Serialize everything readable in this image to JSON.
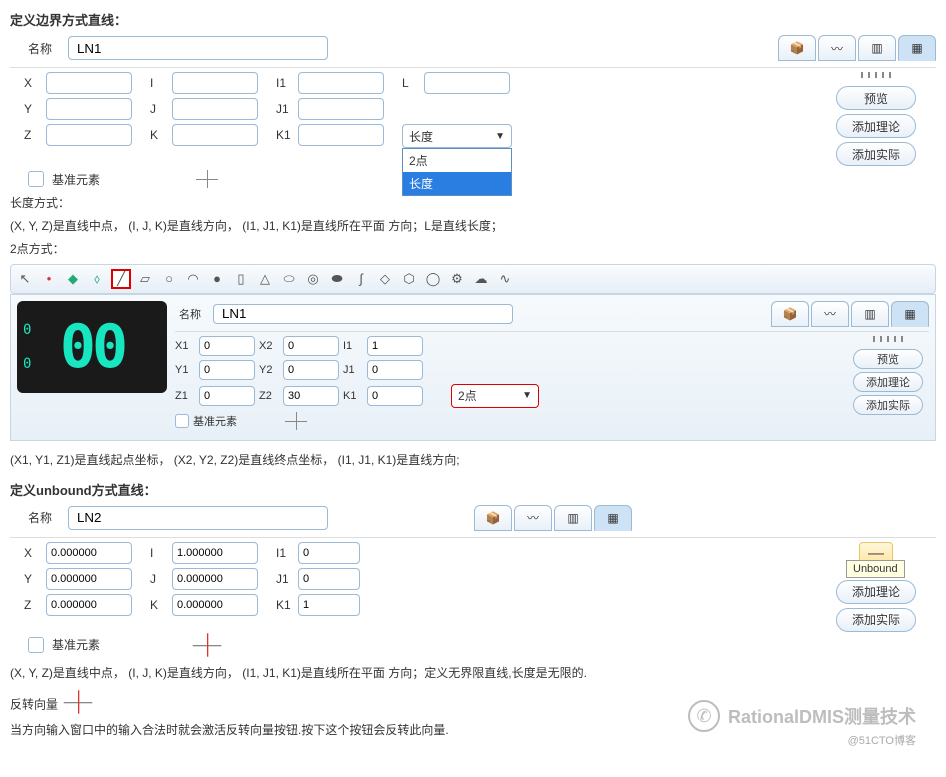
{
  "sec1": {
    "title": "定义边界方式直线：",
    "name_label": "名称",
    "name_value": "LN1",
    "labels": {
      "X": "X",
      "Y": "Y",
      "Z": "Z",
      "I": "I",
      "J": "J",
      "K": "K",
      "I1": "I1",
      "J1": "J1",
      "K1": "K1",
      "L": "L"
    },
    "datum": "基准元素",
    "dropdown": {
      "current": "长度",
      "opt1": "2点",
      "opt2": "长度"
    },
    "buttons": {
      "preview": "预览",
      "addTheory": "添加理论",
      "addActual": "添加实际"
    },
    "desc_label": "长度方式：",
    "desc": "(X, Y, Z)是直线中点， (I, J, K)是直线方向， (I1, J1, K1)是直线所在平面 方向；L是直线长度；",
    "desc2_label": "2点方式："
  },
  "sec2": {
    "name_label": "名称",
    "name_value": "LN1",
    "counter": "00",
    "counter_side1": "0",
    "counter_side2": "0",
    "labels": {
      "X1": "X1",
      "Y1": "Y1",
      "Z1": "Z1",
      "X2": "X2",
      "Y2": "Y2",
      "Z2": "Z2",
      "I1": "I1",
      "J1": "J1",
      "K1": "K1"
    },
    "vals": {
      "X1": "0",
      "Y1": "0",
      "Z1": "0",
      "X2": "0",
      "Y2": "0",
      "Z2": "30",
      "I1": "1",
      "J1": "0",
      "K1": "0"
    },
    "dropdown": "2点",
    "datum": "基准元素",
    "buttons": {
      "preview": "预览",
      "addTheory": "添加理论",
      "addActual": "添加实际"
    },
    "desc": "(X1, Y1, Z1)是直线起点坐标， (X2, Y2, Z2)是直线终点坐标， (I1, J1, K1)是直线方向;"
  },
  "sec3": {
    "title": "定义unbound方式直线：",
    "name_label": "名称",
    "name_value": "LN2",
    "labels": {
      "X": "X",
      "Y": "Y",
      "Z": "Z",
      "I": "I",
      "J": "J",
      "K": "K",
      "I1": "I1",
      "J1": "J1",
      "K1": "K1"
    },
    "vals": {
      "X": "0.000000",
      "Y": "0.000000",
      "Z": "0.000000",
      "I": "1.000000",
      "J": "0.000000",
      "K": "0.000000",
      "I1": "0",
      "J1": "0",
      "K1": "1"
    },
    "datum": "基准元素",
    "tooltip": "Unbound",
    "buttons": {
      "addTheory": "添加理论",
      "addActual": "添加实际"
    },
    "desc": "(X, Y, Z)是直线中点， (I, J, K)是直线方向， (I1, J1, K1)是直线所在平面 方向；定义无界限直线,长度是无限的."
  },
  "sec4": {
    "title": "反转向量",
    "desc": "当方向输入窗口中的输入合法时就会激活反转向量按钮.按下这个按钮会反转此向量."
  },
  "watermark": {
    "text": "RationalDMIS测量技术",
    "sub": "@51CTO博客"
  }
}
